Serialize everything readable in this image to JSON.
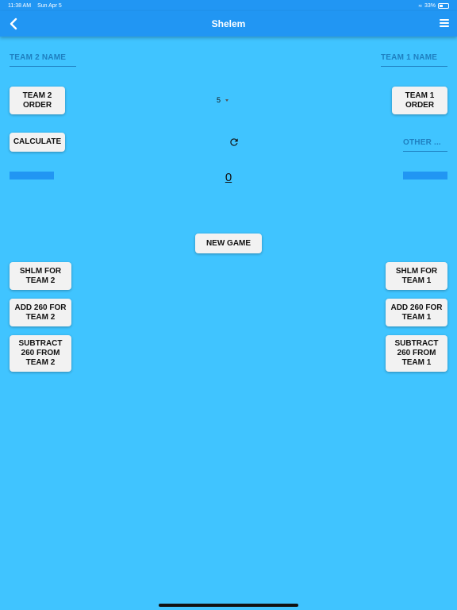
{
  "status": {
    "time": "11:38 AM",
    "date": "Sun Apr 5",
    "battery": "33%"
  },
  "app_bar": {
    "title": "Shelem"
  },
  "fields": {
    "team2_name": "TEAM 2 NAME",
    "team1_name": "TEAM 1 NAME",
    "other": "OTHER ..."
  },
  "buttons": {
    "team2_order": "TEAM 2 ORDER",
    "team1_order": "TEAM 1 ORDER",
    "calculate": "CALCULATE",
    "new_game": "NEW GAME",
    "shlm_team2": "SHLM FOR TEAM 2",
    "shlm_team1": "SHLM FOR TEAM 1",
    "add260_team2": "ADD 260 FOR TEAM 2",
    "add260_team1": "ADD 260 FOR TEAM 1",
    "sub260_team2": "SUBTRACT 260 FROM TEAM 2",
    "sub260_team1": "SUBTRACT 260 FROM TEAM 1"
  },
  "dropdown": {
    "value": "5"
  },
  "score": {
    "value": "0"
  },
  "colors": {
    "background": "#40c4ff",
    "app_bar": "#2196f3",
    "accent_text": "#1e7fc0"
  },
  "icons": {
    "back": "chevron-left-icon",
    "menu": "hamburger-menu-icon",
    "refresh": "refresh-icon"
  }
}
